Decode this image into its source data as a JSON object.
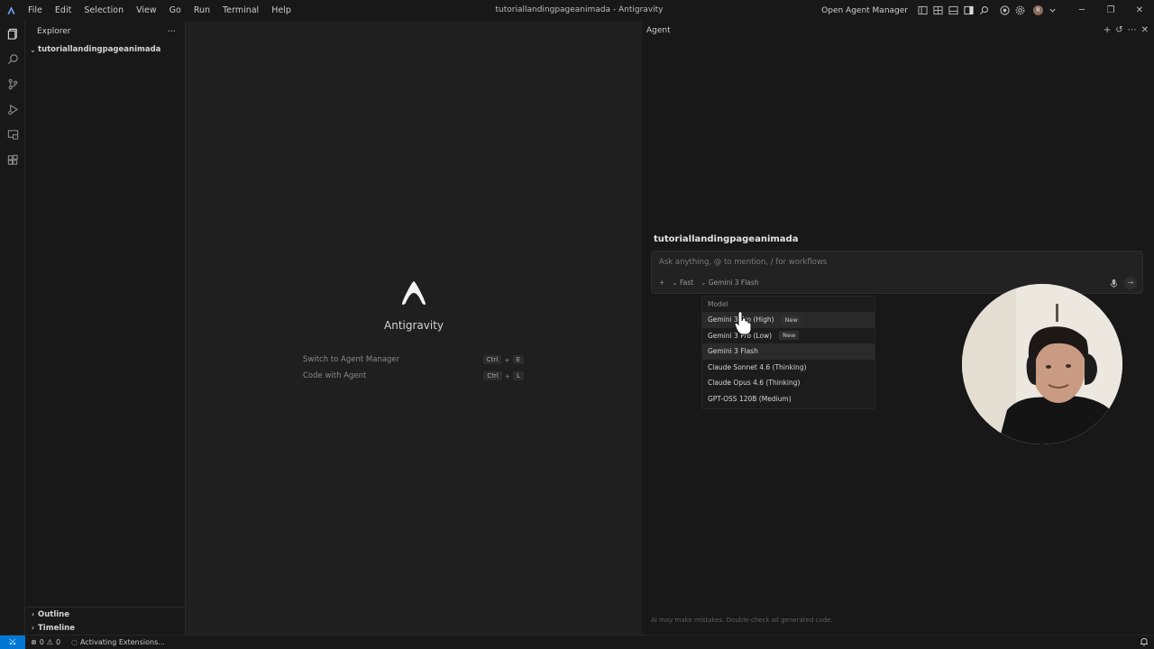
{
  "window": {
    "title": "tutoriallandingpageanimada - Antigravity",
    "open_agent_manager": "Open Agent Manager",
    "avatar_letter": "R"
  },
  "menu": [
    "File",
    "Edit",
    "Selection",
    "View",
    "Go",
    "Run",
    "Terminal",
    "Help"
  ],
  "activity_bar": [
    "explorer-icon",
    "search-icon",
    "source-control-icon",
    "run-debug-icon",
    "remote-explorer-icon",
    "extensions-icon"
  ],
  "sidebar": {
    "title": "Explorer",
    "more": "···",
    "folder": "tutoriallandingpageanimada",
    "outline": "Outline",
    "timeline": "Timeline"
  },
  "editor": {
    "app_name": "Antigravity",
    "shortcuts": [
      {
        "label": "Switch to Agent Manager",
        "mod": "Ctrl",
        "plus": "+",
        "key": "E"
      },
      {
        "label": "Code with Agent",
        "mod": "Ctrl",
        "plus": "+",
        "key": "L"
      }
    ]
  },
  "agent": {
    "title": "Agent",
    "workspace": "tutoriallandingpageanimada",
    "input_placeholder": "Ask anything, @ to mention, / for workflows",
    "add": "+",
    "mode": "Fast",
    "model": "Gemini 3 Flash",
    "disclaimer": "AI may make mistakes. Double-check all generated code.",
    "model_menu": {
      "header": "Model",
      "items": [
        {
          "label": "Gemini 3 Pro (High)",
          "badge": "New"
        },
        {
          "label": "Gemini 3 Pro (Low)",
          "badge": "New"
        },
        {
          "label": "Gemini 3 Flash",
          "badge": ""
        },
        {
          "label": "Claude Sonnet 4.6 (Thinking)",
          "badge": ""
        },
        {
          "label": "Claude Opus 4.6 (Thinking)",
          "badge": ""
        },
        {
          "label": "GPT-OSS 120B (Medium)",
          "badge": ""
        }
      ]
    }
  },
  "statusbar": {
    "errors": "0",
    "warnings": "0",
    "activity": "Activating Extensions..."
  },
  "colors": {
    "accent": "#0078d4",
    "background": "#1f1f1f",
    "panel": "#181818"
  }
}
